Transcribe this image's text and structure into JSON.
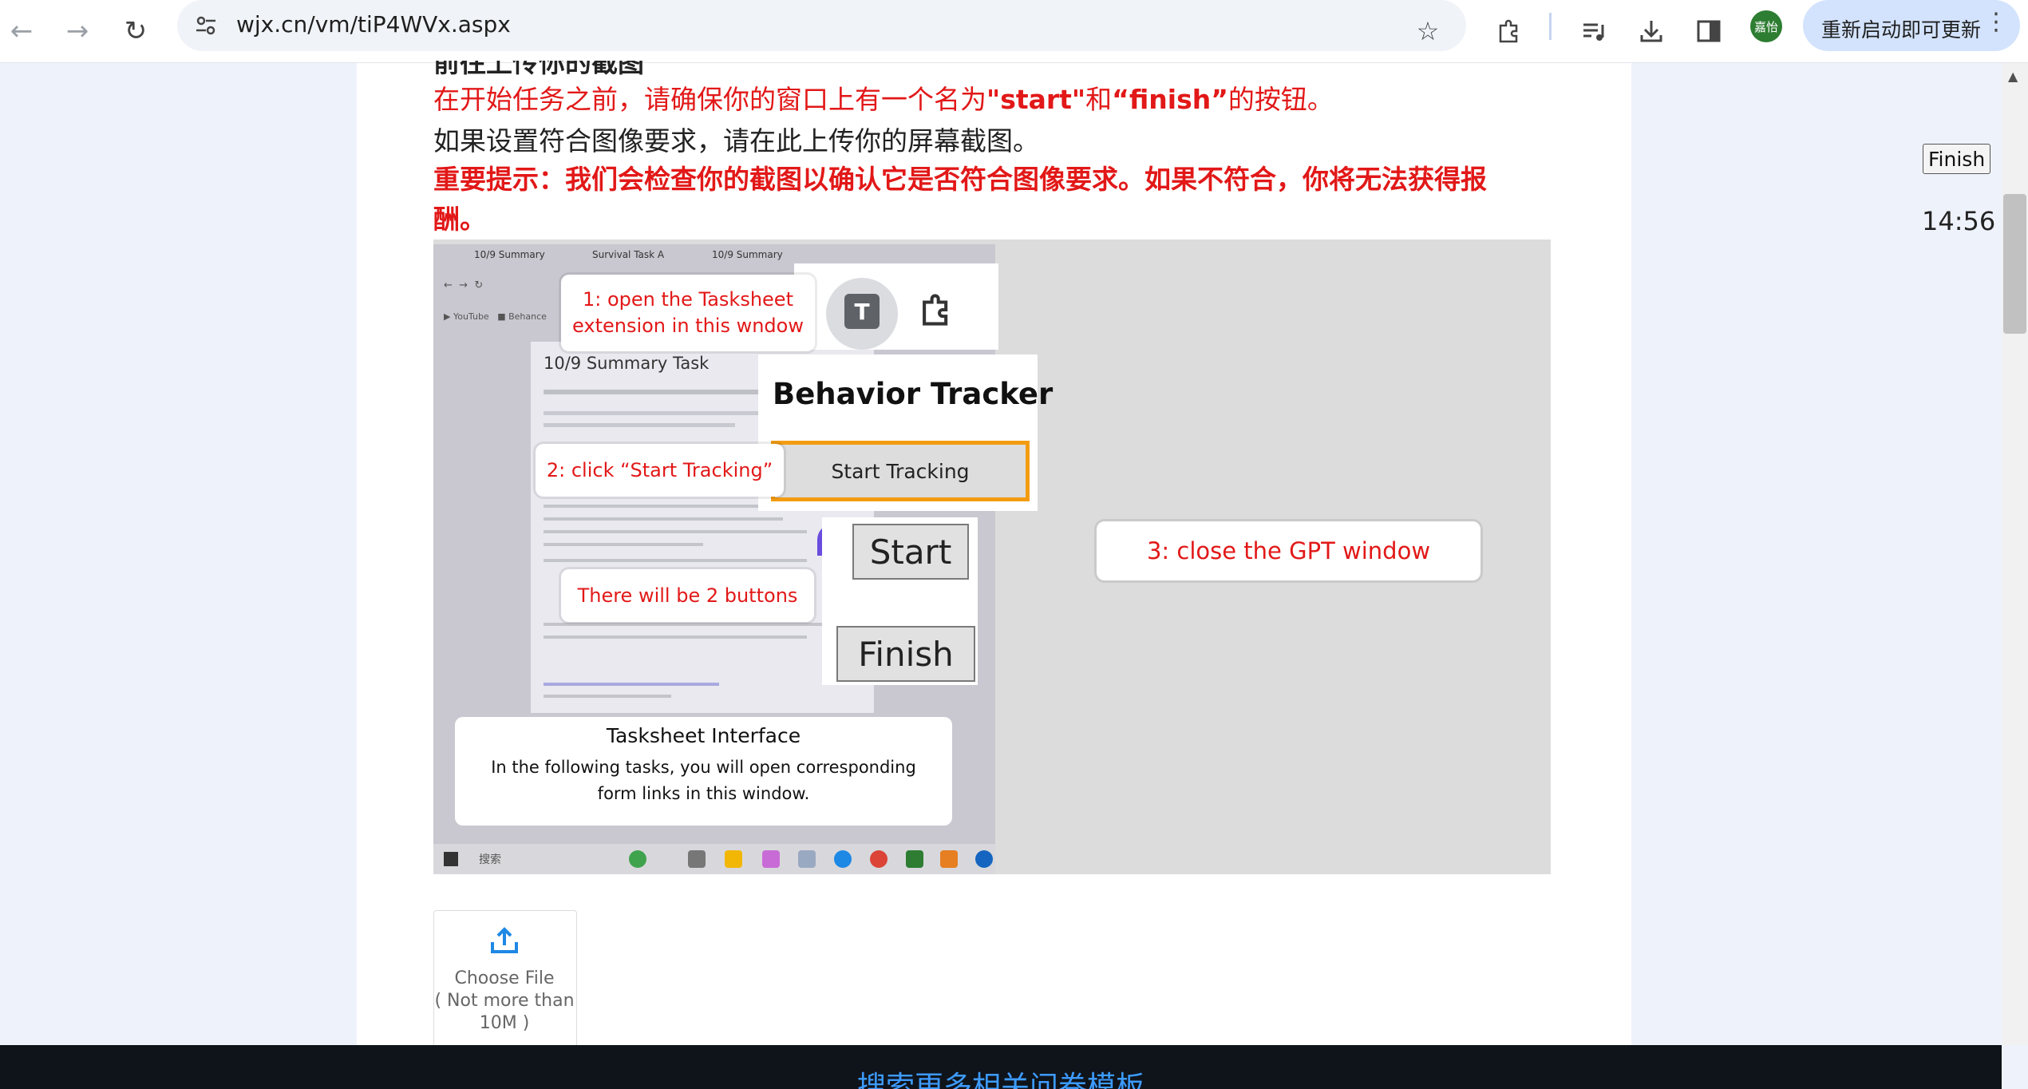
{
  "browser": {
    "url": "wjx.cn/vm/tiP4WVx.aspx",
    "avatar_text": "嘉怡",
    "update_button": "重新启动即可更新"
  },
  "question": {
    "cut_heading": "前往上传你的截图",
    "line1_prefix": "在开始任务之前，请确保你的窗口上有一个名为",
    "line1_start": "\"start\"",
    "line1_and": "和",
    "line1_finish": "“finish”",
    "line1_suffix": "的按钮。",
    "line2": "如果设置符合图像要求，请在此上传你的屏幕截图。",
    "line3": "重要提示：我们会检查你的截图以确认它是否符合图像要求。如果不符合，你将无法获得报酬。"
  },
  "illustration": {
    "tabs": [
      "10/9 Summary",
      "Survival Task A",
      "10/9 Summary"
    ],
    "bookmarks": [
      "YouTube",
      "Behance"
    ],
    "doc_title": "10/9 Summary Task",
    "callout1": "1: open the Tasksheet\nextension in this wndow",
    "tracker_title": "Behavior Tracker",
    "tracker_button": "Start Tracking",
    "callout2": "2: click “Start Tracking”",
    "callout3": "3: close the GPT window",
    "callout4": "There will be 2 buttons",
    "start_button": "Start",
    "finish_button": "Finish",
    "t_icon_letter": "T",
    "taskbar_search": "搜索",
    "tasksheet_title": "Tasksheet Interface",
    "tasksheet_text": "In the following tasks, you will open corresponding form links in this window."
  },
  "upload": {
    "label": "Choose File",
    "limit": "( Not more than 10M )"
  },
  "side": {
    "finish_label": "Finish",
    "timer": "14:56"
  },
  "footer": {
    "link_text": "搜索更多相关问卷模板"
  },
  "colors": {
    "accent_red": "#e21818",
    "orange_border": "#f39c12",
    "link_blue": "#3d9bff",
    "upload_blue": "#1e88e5"
  }
}
